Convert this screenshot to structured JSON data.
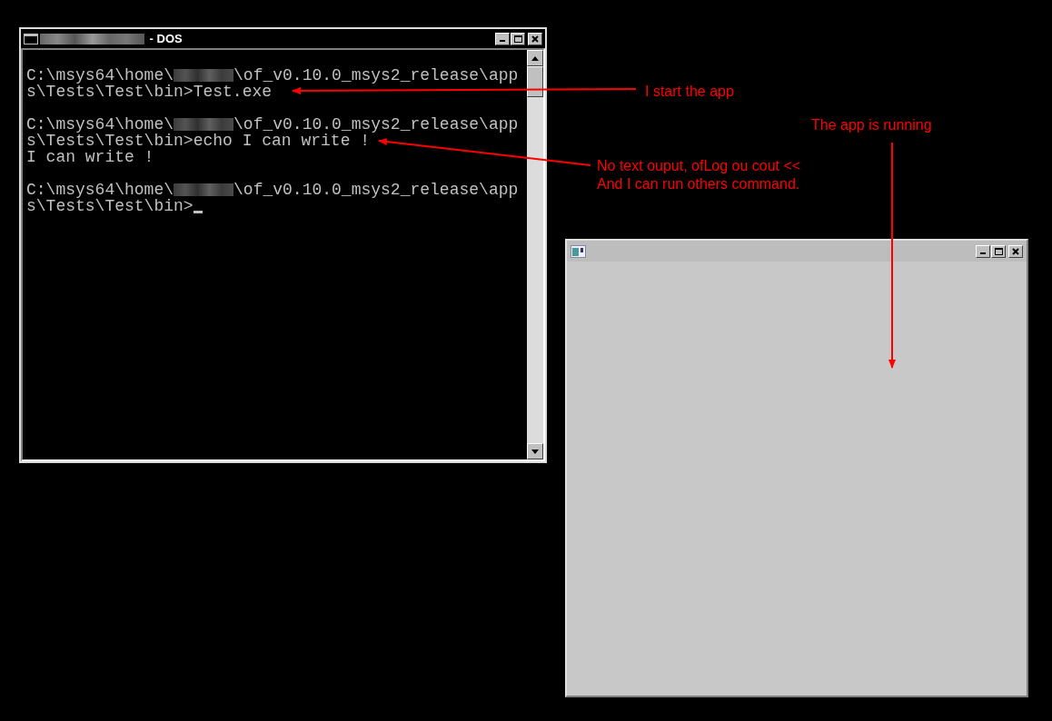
{
  "console_window": {
    "title": "- DOS",
    "blocks": [
      {
        "lines": [
          {
            "kind": "redacted_path",
            "prefix": "C:\\msys64\\home\\",
            "suffix": "\\of_v0.10.0_msys2_release\\app"
          },
          {
            "kind": "plain",
            "text": "s\\Tests\\Test\\bin>Test.exe"
          }
        ]
      },
      {
        "lines": [
          {
            "kind": "redacted_path",
            "prefix": "C:\\msys64\\home\\",
            "suffix": "\\of_v0.10.0_msys2_release\\app"
          },
          {
            "kind": "plain",
            "text": "s\\Tests\\Test\\bin>echo I can write !"
          },
          {
            "kind": "plain",
            "text": "I can write !"
          }
        ]
      },
      {
        "lines": [
          {
            "kind": "redacted_path",
            "prefix": "C:\\msys64\\home\\",
            "suffix": "\\of_v0.10.0_msys2_release\\app"
          },
          {
            "kind": "plain",
            "text": "s\\Tests\\Test\\bin>"
          }
        ]
      }
    ],
    "cursor": true
  },
  "app_window": {
    "title_icon": true
  },
  "annotations": [
    {
      "text": "I start the app"
    },
    {
      "text": "The app is running"
    },
    {
      "text": "No text ouput, ofLog ou cout <<\nAnd I can run others command."
    }
  ]
}
